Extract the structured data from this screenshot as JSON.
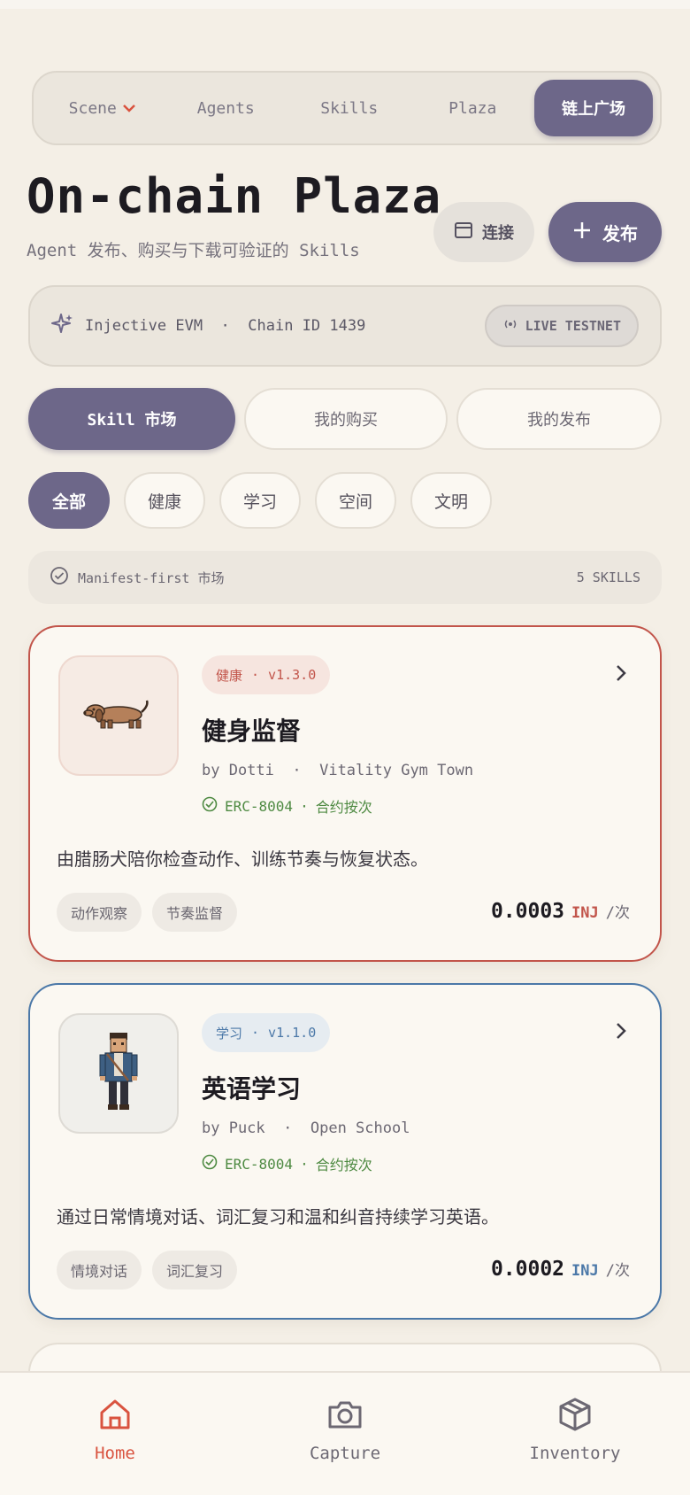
{
  "nav": {
    "items": [
      {
        "label": "Scene",
        "has_dropdown": true
      },
      {
        "label": "Agents"
      },
      {
        "label": "Skills"
      },
      {
        "label": "Plaza"
      },
      {
        "label": "链上广场",
        "active": true
      }
    ]
  },
  "header": {
    "title": "On-chain Plaza",
    "subtitle": "Agent 发布、购买与下载可验证的 Skills",
    "connect_label": "连接",
    "publish_label": "发布"
  },
  "chain": {
    "network": "Injective EVM",
    "chain_id": "Chain ID 1439",
    "status": "LIVE TESTNET"
  },
  "tabs": [
    {
      "label": "Skill 市场",
      "active": true
    },
    {
      "label": "我的购买"
    },
    {
      "label": "我的发布"
    }
  ],
  "filters": [
    {
      "label": "全部",
      "active": true
    },
    {
      "label": "健康"
    },
    {
      "label": "学习"
    },
    {
      "label": "空间"
    },
    {
      "label": "文明"
    }
  ],
  "info": {
    "label": "Manifest-first 市场",
    "count": "5 SKILLS"
  },
  "skills": [
    {
      "category": "健康",
      "version": "v1.3.0",
      "title": "健身监督",
      "author": "by Dotti",
      "location": "Vitality Gym Town",
      "standard": "ERC-8004",
      "billing": "合约按次",
      "description": "由腊肠犬陪你检查动作、训练节奏与恢复状态。",
      "tags": [
        "动作观察",
        "节奏监督"
      ],
      "price": "0.0003",
      "unit": "INJ",
      "per": "/次",
      "accent": "#c2554b",
      "icon": "dachshund-icon"
    },
    {
      "category": "学习",
      "version": "v1.1.0",
      "title": "英语学习",
      "author": "by Puck",
      "location": "Open School",
      "standard": "ERC-8004",
      "billing": "合约按次",
      "description": "通过日常情境对话、词汇复习和温和纠音持续学习英语。",
      "tags": [
        "情境对话",
        "词汇复习"
      ],
      "price": "0.0002",
      "unit": "INJ",
      "per": "/次",
      "accent": "#4b78a8",
      "icon": "student-icon"
    }
  ],
  "bottom_nav": [
    {
      "label": "Home",
      "active": true,
      "icon": "home-icon"
    },
    {
      "label": "Capture",
      "icon": "camera-icon"
    },
    {
      "label": "Inventory",
      "icon": "box-icon"
    }
  ],
  "colors": {
    "accent": "#6d6789",
    "brand_red": "#d9533f",
    "background": "#f4efe6"
  }
}
